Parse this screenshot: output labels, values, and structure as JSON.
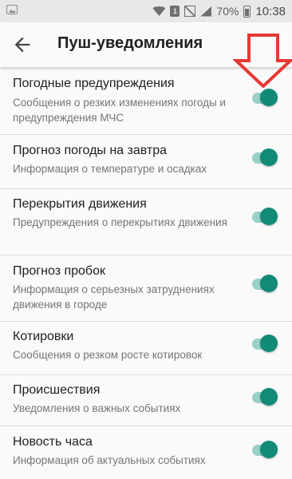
{
  "status_bar": {
    "battery_percent": "70%",
    "time": "10:38",
    "sim_label": "1"
  },
  "header": {
    "title": "Пуш-уведомления",
    "back_icon": "arrow-left-icon"
  },
  "colors": {
    "accent": "#118a76",
    "toggle_track": "#98d1c8",
    "annotation_arrow": "#e53935"
  },
  "settings": [
    {
      "title": "Погодные предупреждения",
      "subtitle": "Сообщения о резких изменениях погоды и предупреждения МЧС",
      "enabled": true
    },
    {
      "title": "Прогноз погоды на завтра",
      "subtitle": "Информация о температуре и осадках",
      "enabled": true
    },
    {
      "title": "Перекрытия движения",
      "subtitle": "Предупреждения о перекрытиях движения",
      "enabled": true
    },
    {
      "title": "Прогноз пробок",
      "subtitle": "Информация о серьезных затруднениях движения в городе",
      "enabled": true
    },
    {
      "title": "Котировки",
      "subtitle": "Сообщения о резком росте котировок",
      "enabled": true
    },
    {
      "title": "Происшествия",
      "subtitle": "Уведомления о важных событиях",
      "enabled": true
    },
    {
      "title": "Новость часа",
      "subtitle": "Информация об актуальных событиях",
      "enabled": true
    }
  ]
}
